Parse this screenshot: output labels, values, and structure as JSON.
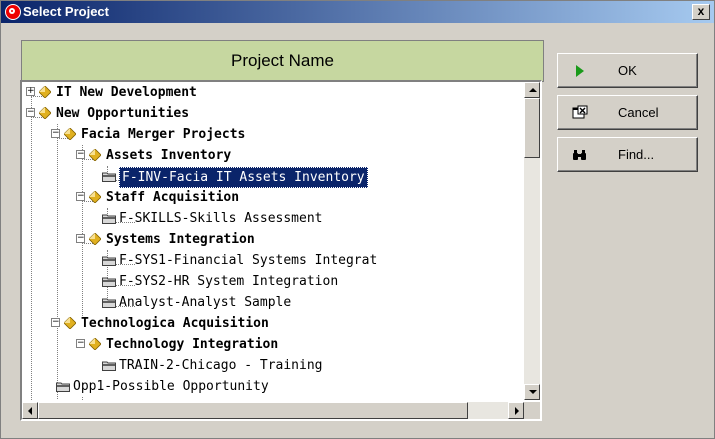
{
  "window": {
    "title": "Select Project",
    "close_label": "x"
  },
  "table": {
    "column_header": "Project Name"
  },
  "tree": {
    "items": [
      {
        "label": "IT New Development",
        "level": 0,
        "type": "group",
        "expanded": false
      },
      {
        "label": "New Opportunities",
        "level": 0,
        "type": "group",
        "expanded": true
      },
      {
        "label": "Facia Merger Projects",
        "level": 1,
        "type": "group",
        "expanded": true
      },
      {
        "label": "Assets Inventory",
        "level": 2,
        "type": "group",
        "expanded": true
      },
      {
        "label": "F-INV-Facia IT Assets Inventory",
        "level": 3,
        "type": "project",
        "selected": true
      },
      {
        "label": "Staff Acquisition",
        "level": 2,
        "type": "group",
        "expanded": true
      },
      {
        "label": "F-SKILLS-Skills Assessment",
        "level": 3,
        "type": "project"
      },
      {
        "label": "Systems Integration",
        "level": 2,
        "type": "group",
        "expanded": true
      },
      {
        "label": "F-SYS1-Financial Systems Integrat",
        "level": 3,
        "type": "project"
      },
      {
        "label": "F-SYS2-HR System Integration",
        "level": 3,
        "type": "project"
      },
      {
        "label": "Analyst-Analyst  Sample",
        "level": 3,
        "type": "project"
      },
      {
        "label": "Technologica Acquisition",
        "level": 1,
        "type": "group",
        "expanded": true
      },
      {
        "label": "Technology Integration",
        "level": 2,
        "type": "group",
        "expanded": true
      },
      {
        "label": "TRAIN-2-Chicago - Training",
        "level": 3,
        "type": "project"
      },
      {
        "label": "Opp1-Possible Opportunity",
        "level": 1,
        "type": "project"
      }
    ]
  },
  "buttons": {
    "ok": {
      "label": "OK",
      "icon": "play-arrow-icon"
    },
    "cancel": {
      "label": "Cancel",
      "icon": "close-window-icon"
    },
    "find": {
      "label": "Find...",
      "icon": "binoculars-icon"
    }
  },
  "colors": {
    "header_bg": "#c6d7a0",
    "selection": "#0a246a",
    "diamond": "#e0b020"
  }
}
